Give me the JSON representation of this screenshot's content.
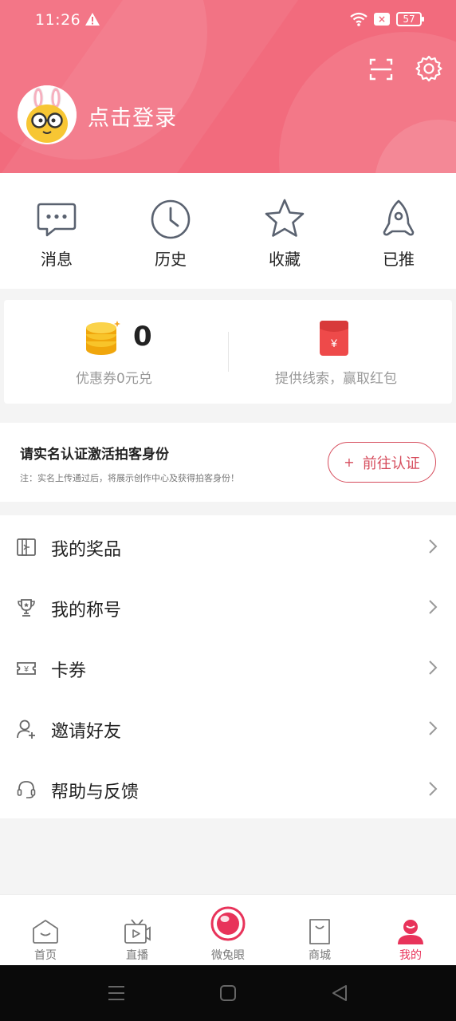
{
  "status_bar": {
    "time": "11:26",
    "battery": "57"
  },
  "header": {
    "login_text": "点击登录"
  },
  "quick_actions": [
    {
      "label": "消息",
      "icon": "message-icon"
    },
    {
      "label": "历史",
      "icon": "clock-icon"
    },
    {
      "label": "收藏",
      "icon": "star-icon"
    },
    {
      "label": "已推",
      "icon": "rocket-icon"
    }
  ],
  "coupon": {
    "count": "0",
    "coupon_label": "优惠券0元兑",
    "clue_label": "提供线索，赢取红包"
  },
  "verify": {
    "title": "请实名认证激活拍客身份",
    "note": "注：实名上传通过后，将展示创作中心及获得拍客身份！",
    "button_label": "前往认证",
    "button_plus": "+"
  },
  "menu": [
    {
      "label": "我的奖品",
      "icon": "prize-icon"
    },
    {
      "label": "我的称号",
      "icon": "trophy-icon"
    },
    {
      "label": "卡券",
      "icon": "ticket-icon"
    },
    {
      "label": "邀请好友",
      "icon": "add-user-icon"
    },
    {
      "label": "帮助与反馈",
      "icon": "headset-icon"
    }
  ],
  "tabs": [
    {
      "label": "首页",
      "icon": "home-icon"
    },
    {
      "label": "直播",
      "icon": "tv-icon"
    },
    {
      "label": "微兔眼",
      "icon": "eye-icon"
    },
    {
      "label": "商城",
      "icon": "bag-icon"
    },
    {
      "label": "我的",
      "icon": "profile-icon",
      "active": true
    }
  ],
  "colors": {
    "header": "#f26b7d",
    "accent": "#e8335a",
    "verify": "#d64c5c",
    "coin": "#f5b614"
  }
}
